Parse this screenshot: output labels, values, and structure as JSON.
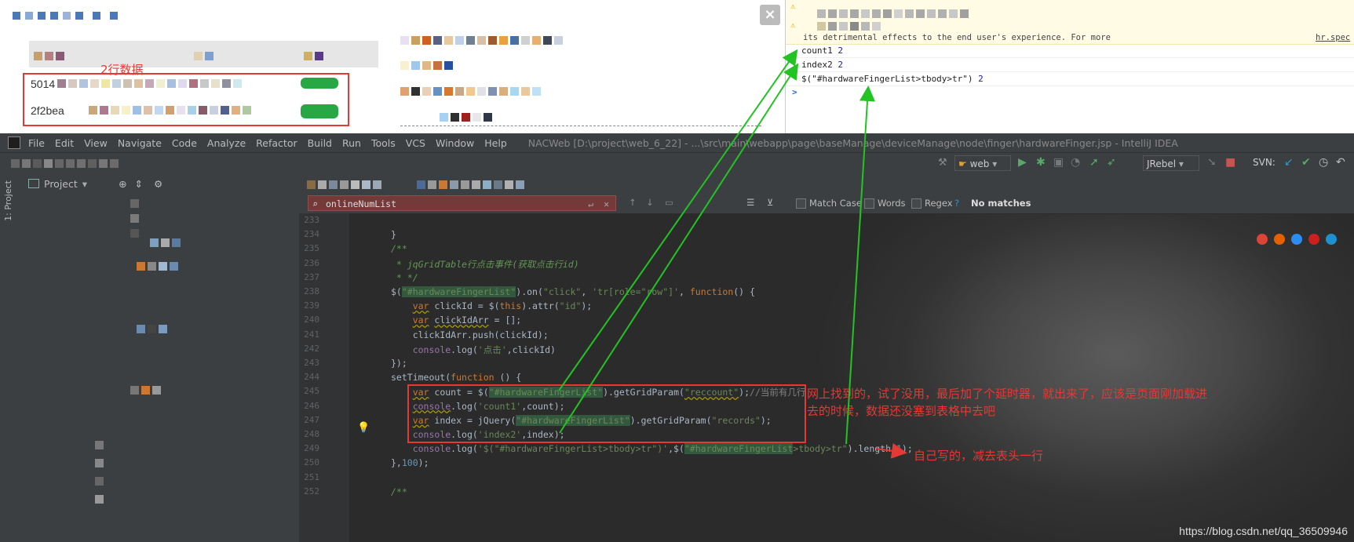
{
  "web": {
    "close_icon": "×",
    "grid_rows": [
      "5014",
      "2f2bea"
    ],
    "rows_note": "2行数据"
  },
  "console": {
    "warning_tail": "its detrimental effects to the end user's experience. For more",
    "warning_link": "hr.spec",
    "logs": [
      {
        "label": "count1",
        "value": "2"
      },
      {
        "label": "index2",
        "value": "2"
      },
      {
        "label": "$(\"#hardwareFingerList>tbody>tr\")",
        "value": "2"
      }
    ],
    "prompt": ">"
  },
  "ide": {
    "menu": [
      "File",
      "Edit",
      "View",
      "Navigate",
      "Code",
      "Analyze",
      "Refactor",
      "Build",
      "Run",
      "Tools",
      "VCS",
      "Window",
      "Help"
    ],
    "title": "NACWeb [D:\\project\\web_6_22] - ...\\src\\main\\webapp\\page\\baseManage\\deviceManage\\node\\finger\\hardwareFinger.jsp - IntelliJ IDEA",
    "toolbar": {
      "run_config": "web",
      "jrebel": "JRebel",
      "svn": "SVN:"
    },
    "side_tab": "1: Project",
    "project_label": "Project",
    "find": {
      "query": "onlineNumList",
      "match_case": "Match Case",
      "words": "Words",
      "regex": "Regex",
      "regex_help": "?",
      "status": "No matches"
    }
  },
  "code_lines": [
    {
      "n": "233",
      "html": ""
    },
    {
      "n": "234",
      "html": "}"
    },
    {
      "n": "235",
      "html": "<span class=\"cm\">/**</span>"
    },
    {
      "n": "236",
      "html": "<span class=\"cm\"> * jqGridTable行点击事件(获取点击行id)</span>"
    },
    {
      "n": "237",
      "html": "<span class=\"cm\"> * */</span>"
    },
    {
      "n": "238",
      "html": "$(<span class=\"strH\">\"#hardwareFingerList\"</span>).on(<span class=\"str\">\"click\"</span>, <span class=\"str\">'tr[role=\"row\"]'</span>, <span class=\"kw\">function</span>() {"
    },
    {
      "n": "239",
      "html": "    <span class=\"kw warnu\">var</span> clickId = $(<span class=\"kw\">this</span>).attr(<span class=\"str\">\"id\"</span>);"
    },
    {
      "n": "240",
      "html": "    <span class=\"kw warnu\">var</span> <span class=\"warnu\">clickIdArr</span> = [];"
    },
    {
      "n": "241",
      "html": "    clickIdArr.push(clickId);"
    },
    {
      "n": "242",
      "html": "    <span class=\"prp\">console</span>.log(<span class=\"str\">'点击'</span>,clickId)"
    },
    {
      "n": "243",
      "html": "});"
    },
    {
      "n": "244",
      "html": "setTimeout(<span class=\"kw\">function</span> () {"
    },
    {
      "n": "245",
      "html": "    <span class=\"kw warnu\">var</span> count = $(<span class=\"strH\">\"#hardwareFingerList\"</span>).getGridParam(<span class=\"str warnu\">\"reccount\"</span>);<span class=\"gry\">//当前有几行</span>"
    },
    {
      "n": "246",
      "html": "    <span class=\"prp warnu\">console</span>.log(<span class=\"str\">'count1'</span>,count);"
    },
    {
      "n": "247",
      "html": "    <span class=\"kw warnu\">var</span> index = jQuery(<span class=\"strH\">\"#hardwareFingerList\"</span>).getGridParam(<span class=\"str\">\"records\"</span>);"
    },
    {
      "n": "248",
      "html": "    <span class=\"prp\">console</span>.log(<span class=\"str\">'index2'</span>,index);"
    },
    {
      "n": "249",
      "html": "    <span class=\"prp\">console</span>.log(<span class=\"str\">'$(\"#hardwareFingerList>tbody>tr\")'</span>,$(<span class=\"strH\">\"#hardwareFingerList</span><span class=\"str\">&gt;tbody&gt;tr\"</span>).length-<span class=\"num\">1</span>);"
    },
    {
      "n": "250",
      "html": "},<span class=\"num\">100</span>);"
    },
    {
      "n": "251",
      "html": ""
    },
    {
      "n": "252",
      "html": "<span class=\"cm\">/**</span>"
    }
  ],
  "annotations": {
    "found_online": "网上找到的，试了没用，最后加了个延时器，就出来了，应该是页面刚加载进去的时候，数据还没塞到表格中去吧",
    "self_written": "自己写的，减去表头一行"
  },
  "watermark": "https://blog.csdn.net/qq_36509946",
  "colors": {
    "annotation_red": "#e53935",
    "arrow_green": "#22c322",
    "ide_bg": "#2b2b2b"
  }
}
